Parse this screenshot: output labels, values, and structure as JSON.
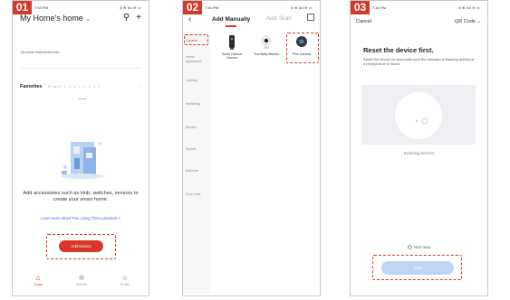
{
  "panels": [
    {
      "step": "01",
      "status": {
        "time": "7:43 PM",
        "sys": "8 ⊕ 5d ≋ ▭"
      },
      "header": {
        "home_name": "My Home's home",
        "chevron": "⌄",
        "mic": "⚲",
        "add": "+"
      },
      "env_info": "No home environment info",
      "favorites": {
        "label": "Favorites",
        "rooms": "Start  ▪ ▪  ▪  ▪  ▪ ▪ ▪  ▪",
        "more": "⋯"
      },
      "add_text": "Add accessories such as Hub, switches, sensors to create your smart home.",
      "learn_more": "Learn more about True Living TECH products >",
      "add_device": "Add Device",
      "nav": [
        {
          "label": "Home",
          "icon": "home-icon"
        },
        {
          "label": "Scenes",
          "icon": "scene-icon"
        },
        {
          "label": "Profile",
          "icon": "profile-icon"
        }
      ]
    },
    {
      "step": "02",
      "status": {
        "time": "7:44 PM",
        "sys": "8 ⊕ 5d ≋ ▭"
      },
      "header": {
        "back": "‹",
        "tab_manual": "Add Manually",
        "tab_auto": "Auto Scan"
      },
      "categories": [
        "Camera",
        "Home Appliances",
        "Lighting",
        "Wellbeing",
        "Electric",
        "Socket",
        "Batteries",
        "Door Lock"
      ],
      "devices": [
        "Smart Outdoor Camera",
        "True Baby Monitor",
        "Pine Camera"
      ]
    },
    {
      "step": "03",
      "status": {
        "time": "7:44 PM",
        "sys": "8 ⊕ 5d ≋ ▭"
      },
      "header": {
        "cancel": "Cancel",
        "qr": "QR Code ⌄"
      },
      "title": "Reset the device first.",
      "body": "Reset the device on and make sure the indicator is flashing quickly or a prompt tone is heard",
      "status_text": "Resetting Devices",
      "next_step": "Next step",
      "next_button": "Next"
    }
  ],
  "colors": {
    "accent": "#d7372a",
    "badge": "#d23a2c",
    "link": "#3a6fd8",
    "disabled_button": "#bfd3f5"
  }
}
